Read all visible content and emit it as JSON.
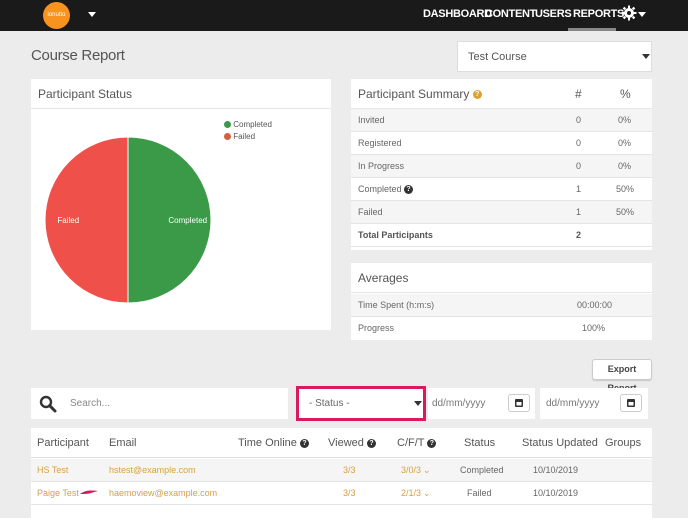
{
  "nav": {
    "logo_text": "ionutto",
    "items": [
      "DASHBOARD",
      "CONTENT",
      "USERS",
      "REPORTS"
    ],
    "active": "REPORTS"
  },
  "page": {
    "title": "Course Report",
    "course_select": "Test Course"
  },
  "status_panel": {
    "title": "Participant Status",
    "legend": [
      {
        "label": "Completed",
        "color": "#3a9a48"
      },
      {
        "label": "Failed",
        "color": "#f0504a"
      }
    ],
    "pie_labels": {
      "failed": "Failed",
      "completed": "Completed"
    }
  },
  "chart_data": {
    "type": "pie",
    "categories": [
      "Completed",
      "Failed"
    ],
    "values": [
      1,
      1
    ],
    "colors": [
      "#3a9a48",
      "#f0504a"
    ],
    "legend": "top-right"
  },
  "summary": {
    "title": "Participant Summary",
    "col_count": "#",
    "col_pct": "%",
    "rows": [
      {
        "label": "Invited",
        "count": "0",
        "pct": "0%"
      },
      {
        "label": "Registered",
        "count": "0",
        "pct": "0%"
      },
      {
        "label": "In Progress",
        "count": "0",
        "pct": "0%"
      },
      {
        "label": "Completed",
        "count": "1",
        "pct": "50%"
      },
      {
        "label": "Failed",
        "count": "1",
        "pct": "50%"
      }
    ],
    "total_label": "Total Participants",
    "total_count": "2"
  },
  "averages": {
    "title": "Averages",
    "rows": [
      {
        "label": "Time Spent (h:m:s)",
        "value": "00:00:00"
      },
      {
        "label": "Progress",
        "value": "100%"
      }
    ]
  },
  "toolbar": {
    "export_label": "Export Report",
    "search_placeholder": "Search...",
    "status_select": "- Status -",
    "date_from_placeholder": "dd/mm/yyyy",
    "date_to_placeholder": "dd/mm/yyyy"
  },
  "participants": {
    "columns": [
      "Participant",
      "Email",
      "Time Online",
      "Viewed",
      "C/F/T",
      "Status",
      "Status Updated",
      "Groups"
    ],
    "rows": [
      {
        "name": "HS Test",
        "email": "hstest@example.com",
        "viewed": "3/3",
        "cft": "3/0/3",
        "status": "Completed",
        "updated": "10/10/2019"
      },
      {
        "name": "Paige Test",
        "email": "haemoview@example.com",
        "viewed": "3/3",
        "cft": "2/1/3",
        "status": "Failed",
        "updated": "10/10/2019"
      }
    ]
  }
}
